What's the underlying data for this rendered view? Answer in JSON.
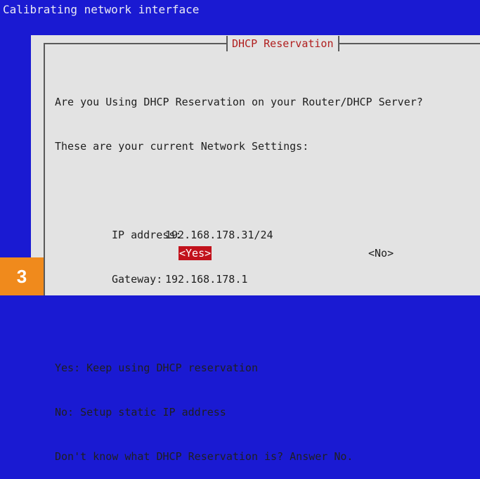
{
  "window": {
    "title": "Calibrating network interface"
  },
  "dialog": {
    "title": "DHCP Reservation",
    "question": "Are you Using DHCP Reservation on your Router/DHCP Server?",
    "intro": "These are your current Network Settings:",
    "settings": {
      "ip_label": "IP address:",
      "ip_value": "192.168.178.31/24",
      "gateway_label": "Gateway:",
      "gateway_value": "192.168.178.1"
    },
    "options": {
      "yes_hint": "Yes: Keep using DHCP reservation",
      "no_hint": "No: Setup static IP address",
      "help": "Don't know what DHCP Reservation is? Answer No."
    },
    "buttons": {
      "yes": "<Yes>",
      "no": "<No>"
    }
  },
  "badge": {
    "step": "3"
  },
  "colors": {
    "background": "#1a1ad2",
    "dialog": "#e3e3e3",
    "title_text": "#b01e1e",
    "selected_button": "#c2121c",
    "badge": "#f08a1c"
  }
}
